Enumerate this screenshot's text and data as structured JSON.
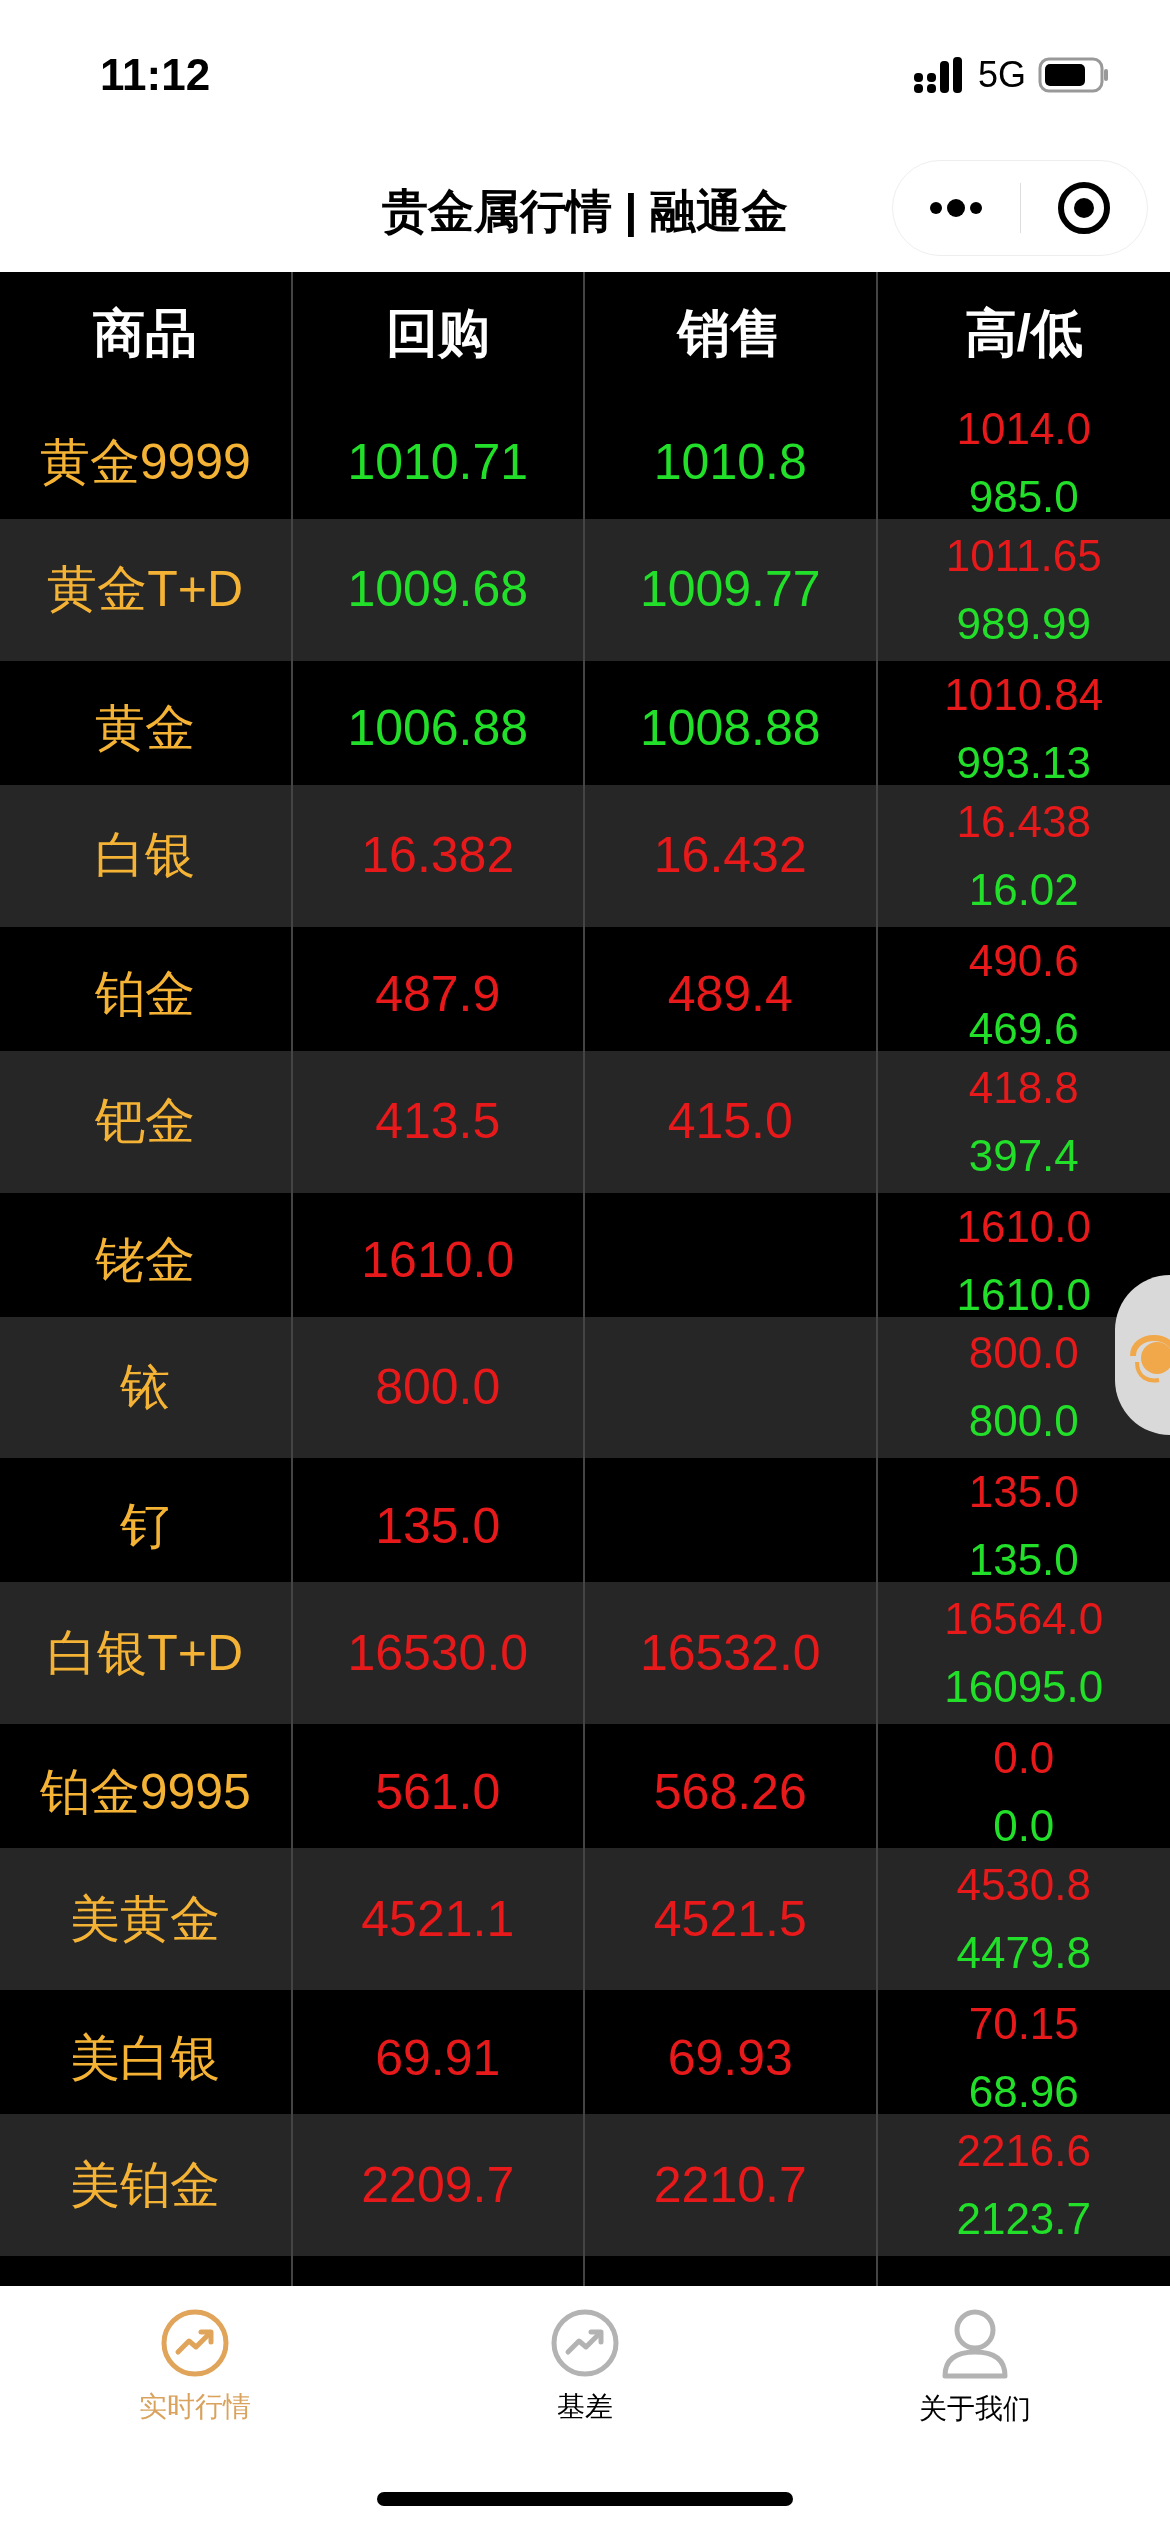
{
  "status_bar": {
    "time": "11:12",
    "network": "5G"
  },
  "header": {
    "title": "贵金属行情 | 融通金"
  },
  "table": {
    "columns": [
      "商品",
      "回购",
      "销售",
      "高/低"
    ],
    "rows": [
      {
        "name": "黄金9999",
        "buy": "1010.71",
        "sell": "1010.8",
        "high": "1014.0",
        "low": "985.0",
        "color": "#22e02a"
      },
      {
        "name": "黄金T+D",
        "buy": "1009.68",
        "sell": "1009.77",
        "high": "1011.65",
        "low": "989.99",
        "color": "#22e02a"
      },
      {
        "name": "黄金",
        "buy": "1006.88",
        "sell": "1008.88",
        "high": "1010.84",
        "low": "993.13",
        "color": "#22e02a"
      },
      {
        "name": "白银",
        "buy": "16.382",
        "sell": "16.432",
        "high": "16.438",
        "low": "16.02",
        "color": "#e8191a"
      },
      {
        "name": "铂金",
        "buy": "487.9",
        "sell": "489.4",
        "high": "490.6",
        "low": "469.6",
        "color": "#e8191a"
      },
      {
        "name": "钯金",
        "buy": "413.5",
        "sell": "415.0",
        "high": "418.8",
        "low": "397.4",
        "color": "#e8191a"
      },
      {
        "name": "铑金",
        "buy": "1610.0",
        "high": "1610.0",
        "low": "1610.0",
        "color": "#e8191a"
      },
      {
        "name": "铱",
        "buy": "800.0",
        "high": "800.0",
        "low": "800.0",
        "color": "#e8191a"
      },
      {
        "name": "钌",
        "buy": "135.0",
        "high": "135.0",
        "low": "135.0",
        "color": "#e8191a"
      },
      {
        "name": "白银T+D",
        "buy": "16530.0",
        "sell": "16532.0",
        "high": "16564.0",
        "low": "16095.0",
        "color": "#e8191a"
      },
      {
        "name": "铂金9995",
        "buy": "561.0",
        "sell": "568.26",
        "high": "0.0",
        "low": "0.0",
        "color": "#e8191a"
      },
      {
        "name": "美黄金",
        "buy": "4521.1",
        "sell": "4521.5",
        "high": "4530.8",
        "low": "4479.8",
        "color": "#e8191a"
      },
      {
        "name": "美白银",
        "buy": "69.91",
        "sell": "69.93",
        "high": "70.15",
        "low": "68.96",
        "color": "#e8191a"
      },
      {
        "name": "美铂金",
        "buy": "2209.7",
        "sell": "2210.7",
        "high": "2216.6",
        "low": "2123.7",
        "color": "#e8191a"
      }
    ]
  },
  "tab_bar": [
    {
      "label": "实时行情",
      "kind": "trend",
      "selected": true
    },
    {
      "label": "基差",
      "kind": "trend",
      "selected": false
    },
    {
      "label": "关于我们",
      "kind": "person",
      "selected": false
    }
  ]
}
